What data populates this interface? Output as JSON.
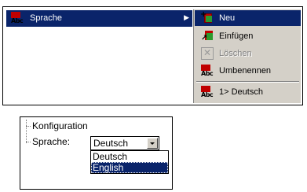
{
  "context_menu": {
    "item": {
      "label": "Sprache",
      "icon": "abc-icon",
      "has_submenu": true
    },
    "submenu": [
      {
        "label": "Neu",
        "icon": "new-icon",
        "state": "active"
      },
      {
        "label": "Einfügen",
        "icon": "insert-icon",
        "state": "normal"
      },
      {
        "label": "Löschen",
        "icon": "delete-icon",
        "state": "disabled"
      },
      {
        "label": "Umbenennen",
        "icon": "abc-icon",
        "state": "normal"
      },
      {
        "label": "1> Deutsch",
        "icon": "abc-icon",
        "state": "normal"
      }
    ]
  },
  "icon_text": "Abc",
  "tree": {
    "items": [
      "Konfiguration",
      "Sprache:"
    ],
    "language_select": {
      "value": "Deutsch",
      "options": [
        "Deutsch",
        "English"
      ],
      "highlighted": "English"
    }
  },
  "colors": {
    "highlight": "#0a246a",
    "menu_bg": "#d4d0c8",
    "icon_red": "#c00000",
    "icon_green": "#2d9a2d"
  }
}
